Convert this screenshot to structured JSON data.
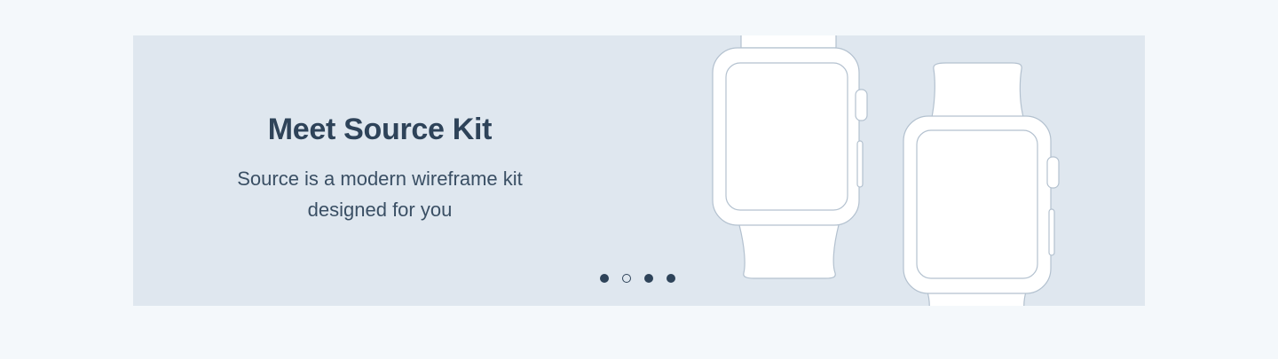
{
  "hero": {
    "title": "Meet Source Kit",
    "description_line1": "Source is a modern wireframe kit",
    "description_line2": "designed for you"
  },
  "carousel": {
    "slide_count": 4,
    "active_states": [
      true,
      false,
      true,
      true
    ]
  },
  "illustration": {
    "icons": [
      "smartwatch-icon",
      "smartwatch-icon"
    ]
  },
  "colors": {
    "page_background": "#f4f8fb",
    "banner_background": "#dfe7ef",
    "text_primary": "#2e4359",
    "outline": "#b3c1cf",
    "screen_fill": "#ffffff"
  }
}
